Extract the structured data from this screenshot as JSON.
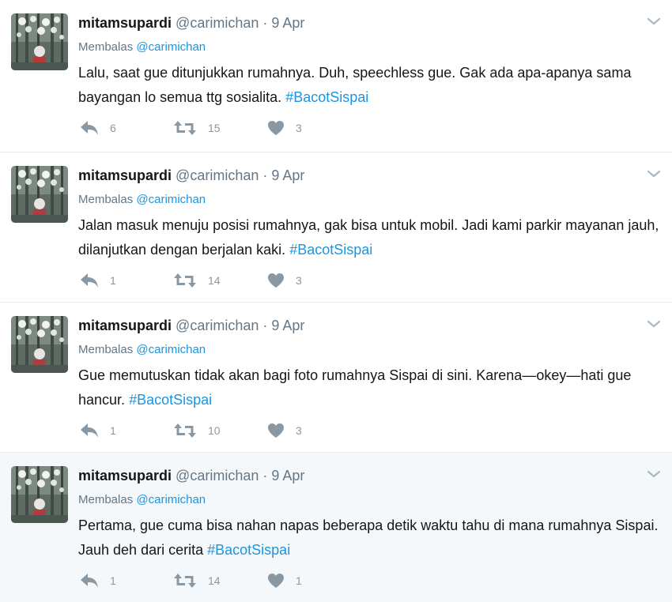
{
  "colors": {
    "link": "#1b95e0",
    "muted": "#657786",
    "action_icon": "#8a98a4",
    "highlight_bg": "#f5f8fa",
    "divider": "#e6ecf0"
  },
  "icons": {
    "reply": "reply-icon",
    "retweet": "retweet-icon",
    "like": "heart-icon",
    "more": "chevron-down-icon"
  },
  "tweets": [
    {
      "name": "mitamsupardi",
      "handle": "@carimichan",
      "dot": "·",
      "time": "9 Apr",
      "reply_prefix": "Membalas",
      "reply_to": "@carimichan",
      "text": "Lalu, saat gue ditunjukkan rumahnya. Duh, speechless gue. Gak ada apa-apanya sama bayangan lo semua ttg sosialita.",
      "hashtag": "#BacotSispai",
      "replies": "6",
      "retweets": "15",
      "likes": "3"
    },
    {
      "name": "mitamsupardi",
      "handle": "@carimichan",
      "dot": "·",
      "time": "9 Apr",
      "reply_prefix": "Membalas",
      "reply_to": "@carimichan",
      "text": "Jalan masuk menuju posisi rumahnya, gak bisa untuk mobil. Jadi kami parkir mayanan jauh, dilanjutkan dengan berjalan kaki.",
      "hashtag": "#BacotSispai",
      "replies": "1",
      "retweets": "14",
      "likes": "3"
    },
    {
      "name": "mitamsupardi",
      "handle": "@carimichan",
      "dot": "·",
      "time": "9 Apr",
      "reply_prefix": "Membalas",
      "reply_to": "@carimichan",
      "text": "Gue memutuskan tidak akan bagi foto rumahnya Sispai di sini. Karena—okey—hati gue hancur.",
      "hashtag": "#BacotSispai",
      "replies": "1",
      "retweets": "10",
      "likes": "3"
    },
    {
      "name": "mitamsupardi",
      "handle": "@carimichan",
      "dot": "·",
      "time": "9 Apr",
      "reply_prefix": "Membalas",
      "reply_to": "@carimichan",
      "text": "Pertama, gue cuma bisa nahan napas beberapa detik waktu tahu di mana rumahnya Sispai. Jauh deh dari cerita",
      "hashtag": "#BacotSispai",
      "replies": "1",
      "retweets": "14",
      "likes": "1"
    }
  ]
}
